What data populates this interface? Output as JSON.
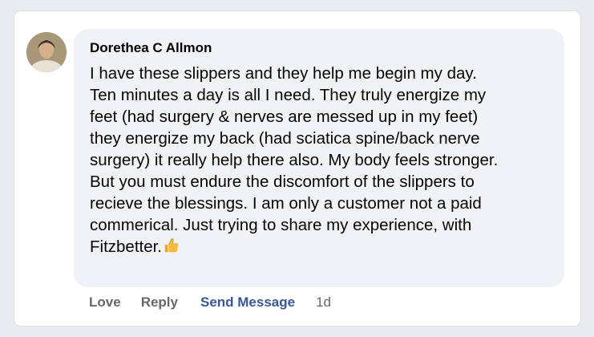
{
  "comment": {
    "author": "Dorethea C Allmon",
    "lines": [
      "I have these slippers and they help me begin my day.",
      "Ten minutes a day is all I need. They truly energize my",
      "feet (had surgery & nerves are messed up in my feet)",
      "they energize my back (had sciatica spine/back nerve",
      "surgery) it really help there also. My body feels stronger.",
      "But you must endure the discomfort of the slippers to",
      "recieve the blessings. I am only a customer not a paid",
      "commerical. Just trying to share my experience, with",
      "Fitzbetter."
    ],
    "emoji_icon": "thumbs-up-icon"
  },
  "actions": {
    "love": "Love",
    "reply": "Reply",
    "send_message": "Send Message",
    "time": "1d"
  },
  "colors": {
    "bubble": "#f0f2f5",
    "link": "#385898",
    "muted": "#65676b"
  }
}
